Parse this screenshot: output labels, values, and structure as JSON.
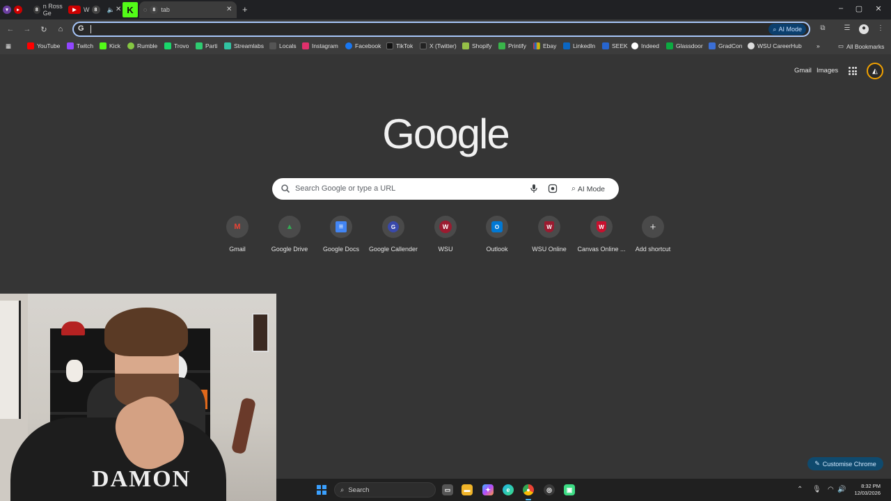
{
  "browser": {
    "tabs": [
      {
        "label": "n Ross Ge"
      },
      {
        "label": "W"
      },
      {
        "label": "tab"
      }
    ],
    "new_tab_glyph": "+",
    "window_controls": [
      "–",
      "▢",
      "✕"
    ],
    "omnibox": {
      "value": "",
      "ai_mode_label": "AI Mode"
    }
  },
  "bookmarks": [
    {
      "label": "YouTube",
      "color": "#ff0000"
    },
    {
      "label": "Twitch",
      "color": "#9146ff"
    },
    {
      "label": "Kick",
      "color": "#53fc18"
    },
    {
      "label": "Rumble",
      "color": "#85c742"
    },
    {
      "label": "Trovo",
      "color": "#19d66b"
    },
    {
      "label": "Parti",
      "color": "#2ecc71"
    },
    {
      "label": "Streamlabs",
      "color": "#31c3a2"
    },
    {
      "label": "Locals",
      "color": "#444444"
    },
    {
      "label": "Instagram",
      "color": "#e1306c"
    },
    {
      "label": "Facebook",
      "color": "#1877f2"
    },
    {
      "label": "TikTok",
      "color": "#111111"
    },
    {
      "label": "X (Twitter)",
      "color": "#222222"
    },
    {
      "label": "Shopify",
      "color": "#95bf47"
    },
    {
      "label": "Printify",
      "color": "#39b54a"
    },
    {
      "label": "Ebay",
      "color": "#e53238"
    },
    {
      "label": "LinkedIn",
      "color": "#0a66c2"
    },
    {
      "label": "SEEK",
      "color": "#2765cf"
    },
    {
      "label": "Indeed",
      "color": "#ffffff"
    },
    {
      "label": "Glassdoor",
      "color": "#0caa41"
    },
    {
      "label": "GradCon",
      "color": "#3b6fd6"
    },
    {
      "label": "WSU CareerHub",
      "color": "#dddddd"
    }
  ],
  "bookmarks_overflow": "»",
  "all_bookmarks_label": "All Bookmarks",
  "google": {
    "gmail_link": "Gmail",
    "images_link": "Images",
    "logo_text": "Google",
    "search_placeholder": "Search Google or type a URL",
    "ai_mode_label": "AI Mode",
    "shortcuts": [
      {
        "label": "Gmail",
        "glyph": "M",
        "color": "#ea4335"
      },
      {
        "label": "Google Drive",
        "glyph": "▲",
        "color": "#34a853"
      },
      {
        "label": "Google Docs",
        "glyph": "≡",
        "color": "#4285f4"
      },
      {
        "label": "Google Callender",
        "glyph": "G",
        "color": "#3949ab"
      },
      {
        "label": "WSU",
        "glyph": "W",
        "color": "#9b1b30"
      },
      {
        "label": "Outlook",
        "glyph": "O",
        "color": "#0078d4"
      },
      {
        "label": "WSU Online",
        "glyph": "W",
        "color": "#9b1b30"
      },
      {
        "label": "Canvas Online ...",
        "glyph": "W",
        "color": "#c8102e"
      },
      {
        "label": "Add shortcut",
        "glyph": "+",
        "color": "#e3e3e3"
      }
    ],
    "customise_label": "Customise Chrome"
  },
  "webcam": {
    "shirt_text": "DAMON"
  },
  "taskbar": {
    "search_label": "Search",
    "clock_time": "8:32 PM",
    "clock_date": "12/03/2026"
  }
}
